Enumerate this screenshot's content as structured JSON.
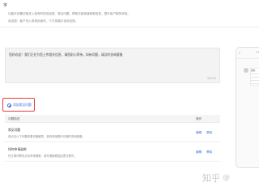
{
  "header": {
    "title": "字",
    "description_line1": "功能可设置访客进入咨询时的欢迎语、常见问题，帮助访客快速获取信息，提升用户服务体验。",
    "description_line2": "欢迎语：客户进入咨询页面时，下方将展示该欢迎语。"
  },
  "welcome": {
    "text": "您好欢迎！我们正在为您上传相关信息，请您耐心等待。如有问题，请及时咨询客服",
    "char_count": "36/100"
  },
  "questions": {
    "add_label": "添加常见问题",
    "columns": [
      "问题描述",
      "操作"
    ],
    "rows": [
      {
        "title": "常见问题",
        "answer": "请点击以下问题查看详细解答，如有其他疑问可随时咨询客服。",
        "actions": [
          "编辑",
          "删除"
        ]
      },
      {
        "title": "如何申请退款",
        "answer": "在订单详情页点击申请退款，填写退款原因后提交即可。",
        "actions": [
          "编辑",
          "删除"
        ]
      }
    ]
  },
  "preview": {
    "back_icon": "chevron-left-icon",
    "bubble_title": "您好"
  },
  "watermark": {
    "brand": "知乎",
    "at": "@"
  },
  "colors": {
    "accent": "#3670e6",
    "highlight_border": "#e23d3d"
  }
}
